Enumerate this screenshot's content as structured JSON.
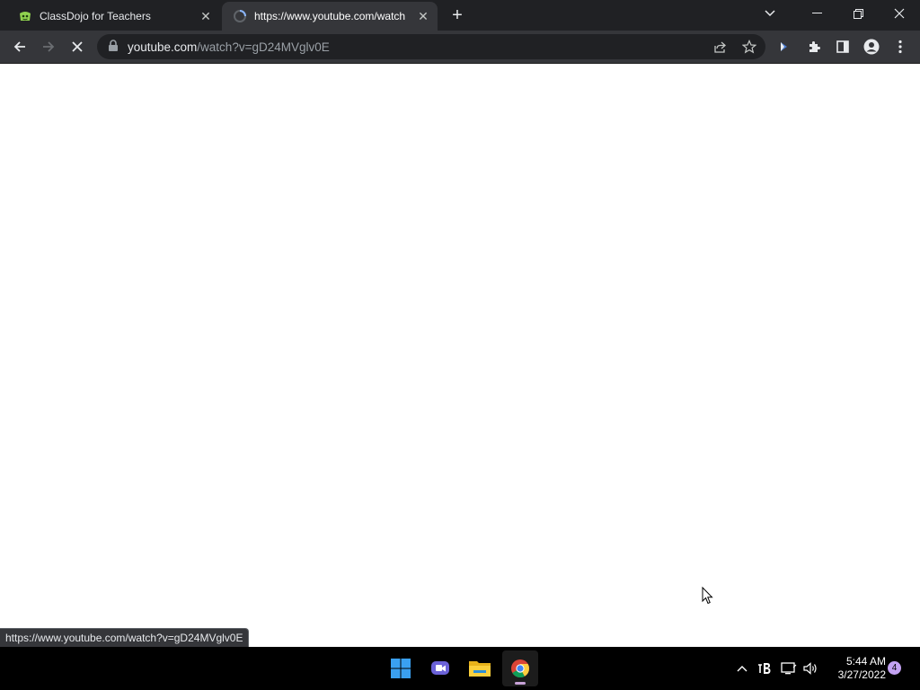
{
  "tabs": [
    {
      "title": "ClassDojo for Teachers",
      "favicon": "classdojo-icon",
      "state": "inactive"
    },
    {
      "title": "https://www.youtube.com/watch",
      "favicon": "loading-spinner-icon",
      "state": "active-loading"
    }
  ],
  "new_tab_label": "+",
  "window_controls": [
    "tab-search",
    "minimize",
    "restore",
    "close"
  ],
  "toolbar": {
    "buttons": [
      "back",
      "forward",
      "stop"
    ]
  },
  "omnibox": {
    "host": "youtube.com",
    "path": "/watch?v=gD24MVglv0E"
  },
  "toolbar_right": [
    "share",
    "bookmark-star",
    "extension-cursor",
    "extensions-puzzle",
    "side-panel",
    "profile",
    "menu"
  ],
  "status_url": "https://www.youtube.com/watch?v=gD24MVglv0E",
  "taskbar": {
    "apps": [
      "start",
      "teams-chat",
      "file-explorer",
      "chrome"
    ],
    "tray": [
      "show-hidden-icons",
      "bluetooth-b",
      "network",
      "volume"
    ],
    "clock": {
      "time": "5:44 AM",
      "date": "3/27/2022"
    },
    "notifications": "4"
  },
  "colors": {
    "tabstrip": "#202124",
    "toolbar": "#35363a",
    "omnibox": "#202124",
    "page": "#ffffff",
    "taskbar": "#000000",
    "notification_badge": "#c3a2f2"
  }
}
